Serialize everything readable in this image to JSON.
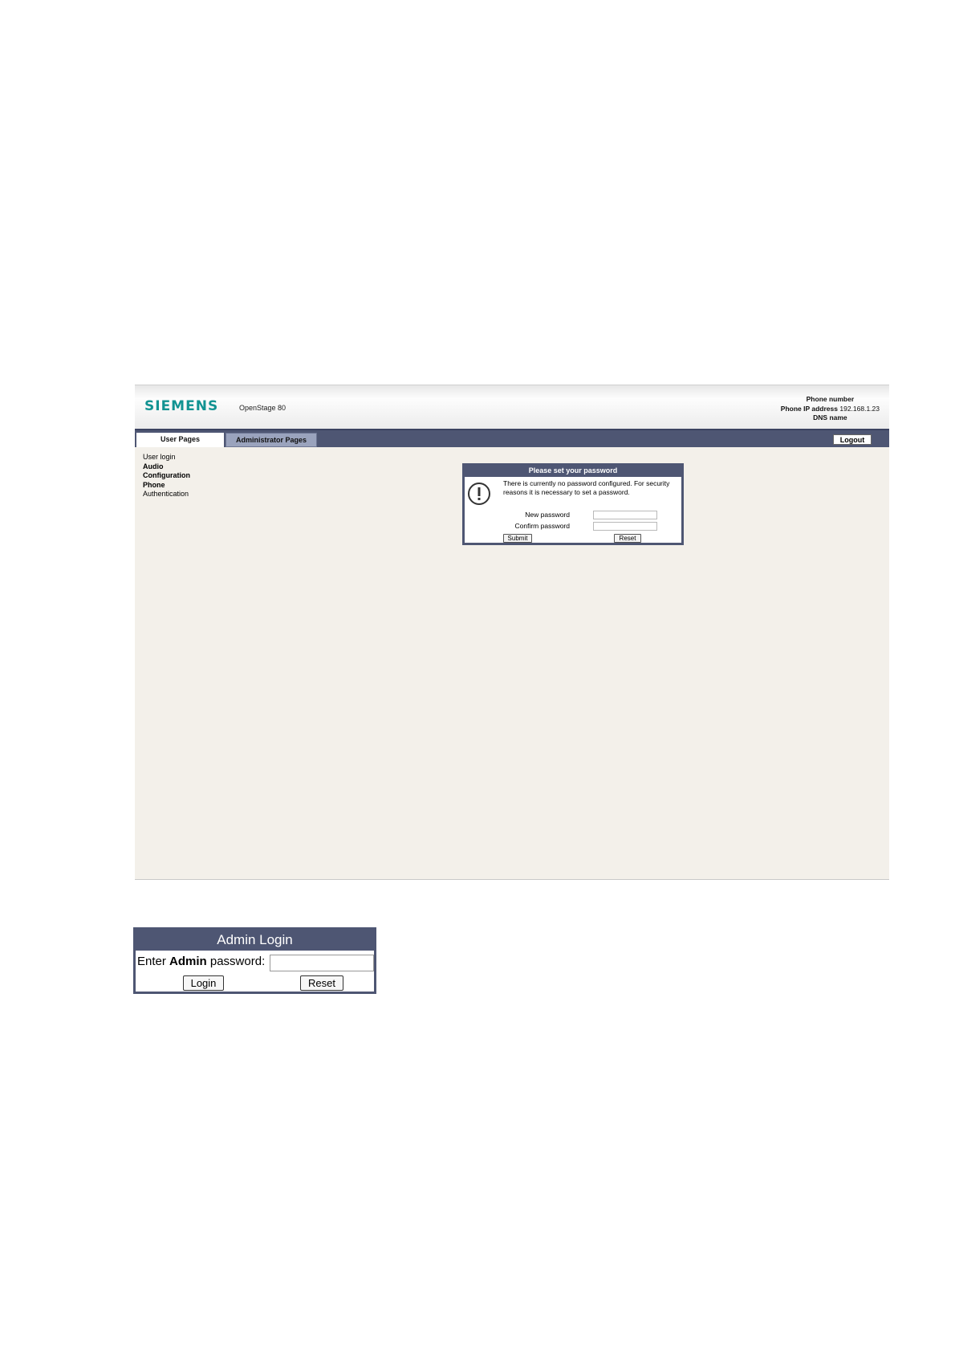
{
  "header": {
    "logo": "SIEMENS",
    "product": "OpenStage 80",
    "phone_number_label": "Phone number",
    "phone_ip_label": "Phone IP address",
    "phone_ip_value": "192.168.1.23",
    "dns_label": "DNS name"
  },
  "tabs": {
    "user": "User Pages",
    "admin": "Administrator Pages",
    "logout": "Logout"
  },
  "sidebar": {
    "items": [
      {
        "label": "User login",
        "bold": false
      },
      {
        "label": "Audio",
        "bold": true
      },
      {
        "label": "Configuration",
        "bold": true
      },
      {
        "label": "Phone",
        "bold": true
      },
      {
        "label": "Authentication",
        "bold": false
      }
    ]
  },
  "password_dialog": {
    "title": "Please set your password",
    "message": "There is currently no password configured. For security reasons it is necessary to set a password.",
    "new_password_label": "New password",
    "confirm_password_label": "Confirm password",
    "submit": "Submit",
    "reset": "Reset"
  },
  "admin_login": {
    "title": "Admin Login",
    "label_prefix": "Enter ",
    "label_bold": "Admin",
    "label_suffix": " password:",
    "login": "Login",
    "reset": "Reset"
  },
  "colors": {
    "brand_teal": "#129392",
    "bar_navy": "#4e5673",
    "page_bg": "#f3f0ea"
  }
}
